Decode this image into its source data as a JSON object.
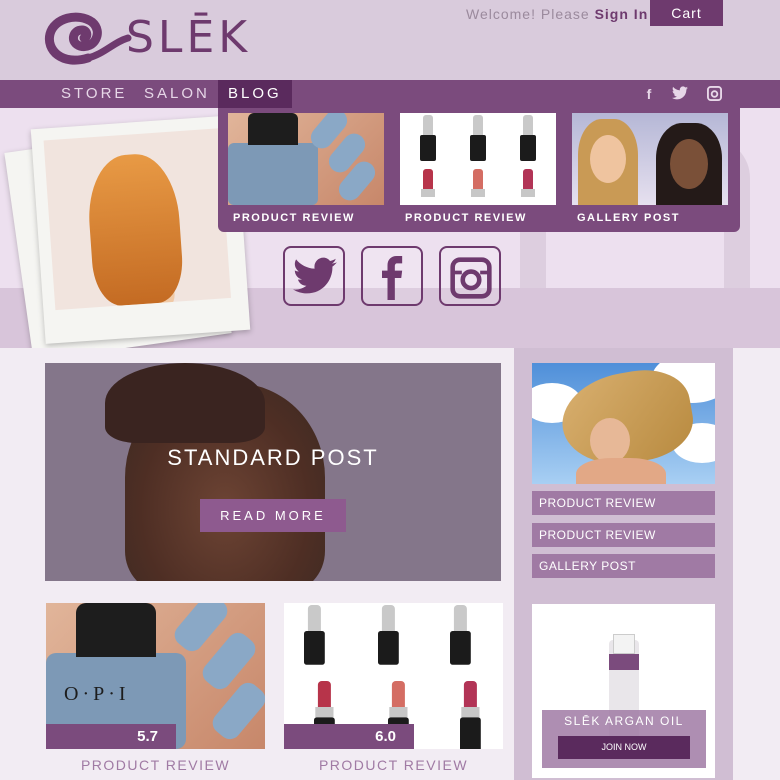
{
  "header": {
    "logo_text": "SLĒK",
    "welcome_text": "Welcome! Please",
    "sign_in": "Sign In",
    "cart": "Cart"
  },
  "nav": {
    "items": [
      "STORE",
      "SALON",
      "BLOG"
    ],
    "active": "BLOG",
    "social_icons": [
      "facebook-icon",
      "twitter-icon",
      "instagram-icon"
    ]
  },
  "dropdown": {
    "cards": [
      {
        "label": "PRODUCT REVIEW"
      },
      {
        "label": "PRODUCT REVIEW"
      },
      {
        "label": "GALLERY POST"
      }
    ]
  },
  "hero_social": [
    "twitter-icon",
    "facebook-icon",
    "instagram-icon"
  ],
  "main_post": {
    "title": "STANDARD POST",
    "button": "READ MORE"
  },
  "sidebar": {
    "links": [
      "PRODUCT REVIEW",
      "PRODUCT REVIEW",
      "GALLERY POST"
    ]
  },
  "promo": {
    "title": "SLĒK ARGAN OIL",
    "button": "JOIN NOW"
  },
  "reviews": [
    {
      "score": "5.7",
      "caption": "PRODUCT REVIEW"
    },
    {
      "score": "6.0",
      "caption": "PRODUCT REVIEW"
    }
  ],
  "colors": {
    "brand": "#6e3a6e",
    "nav": "#7b4b7d",
    "accent": "#a07aa4"
  }
}
